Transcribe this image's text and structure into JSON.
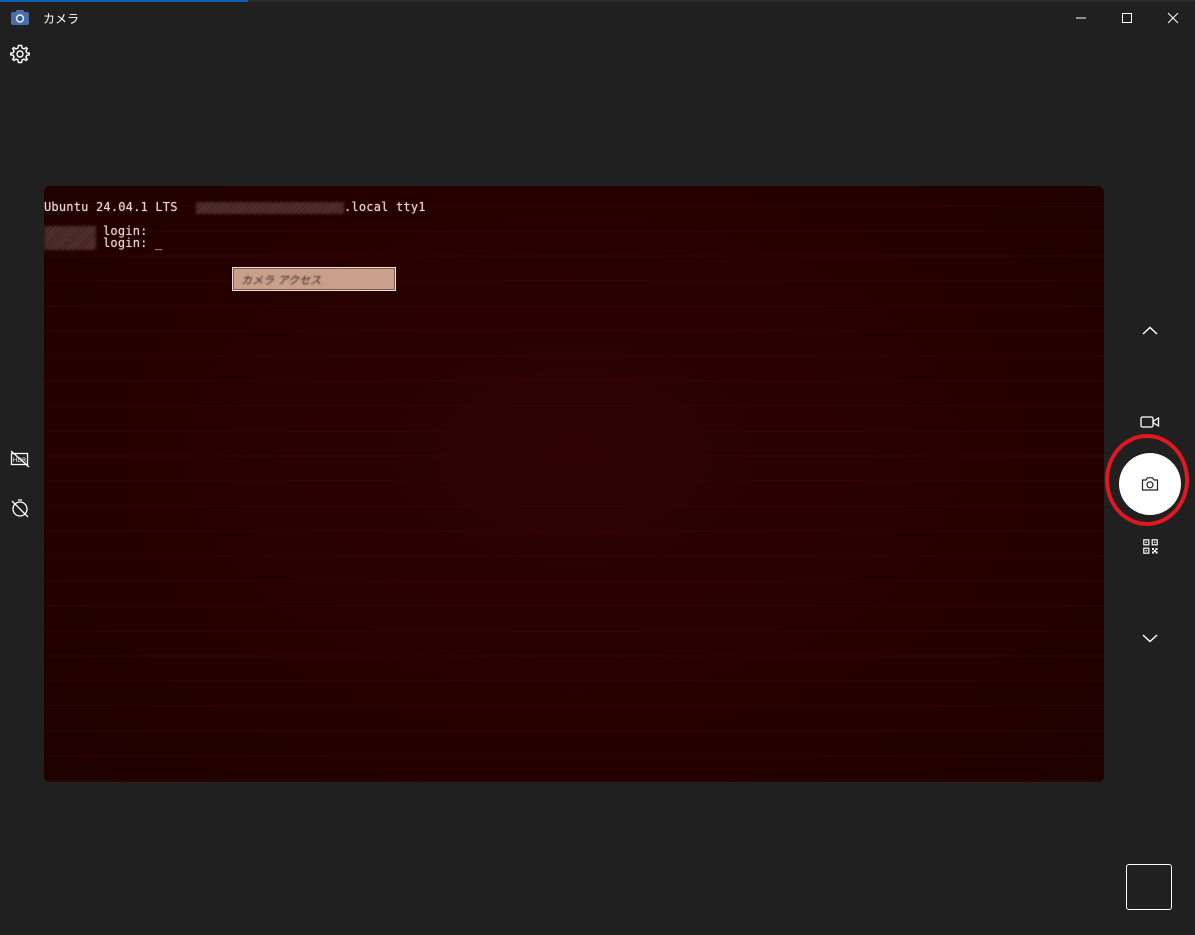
{
  "window": {
    "title": "カメラ",
    "icon": "camera-app-icon"
  },
  "titlebar_buttons": [
    "minimize-icon",
    "maximize-icon",
    "close-icon"
  ],
  "left_toolbar": {
    "settings_icon": "gear-icon",
    "hdr_icon": "hdr-off-icon",
    "timer_icon": "timer-off-icon"
  },
  "preview": {
    "line1_prefix": "Ubuntu 24.04.1 LTS",
    "line1_suffix": ".local tty1",
    "line2": "login:",
    "line3": "login: _",
    "popup_text": "カメラ アクセス"
  },
  "right_toolbar": {
    "scroll_up_icon": "chevron-up-icon",
    "video_mode_icon": "video-camera-icon",
    "photo_button_icon": "camera-icon",
    "qr_icon": "qr-code-icon",
    "scroll_down_icon": "chevron-down-icon",
    "thumbnail": "last-capture-thumbnail"
  },
  "colors": {
    "background": "#202020",
    "highlight": "#e01820",
    "preview_bg": "#260000"
  }
}
